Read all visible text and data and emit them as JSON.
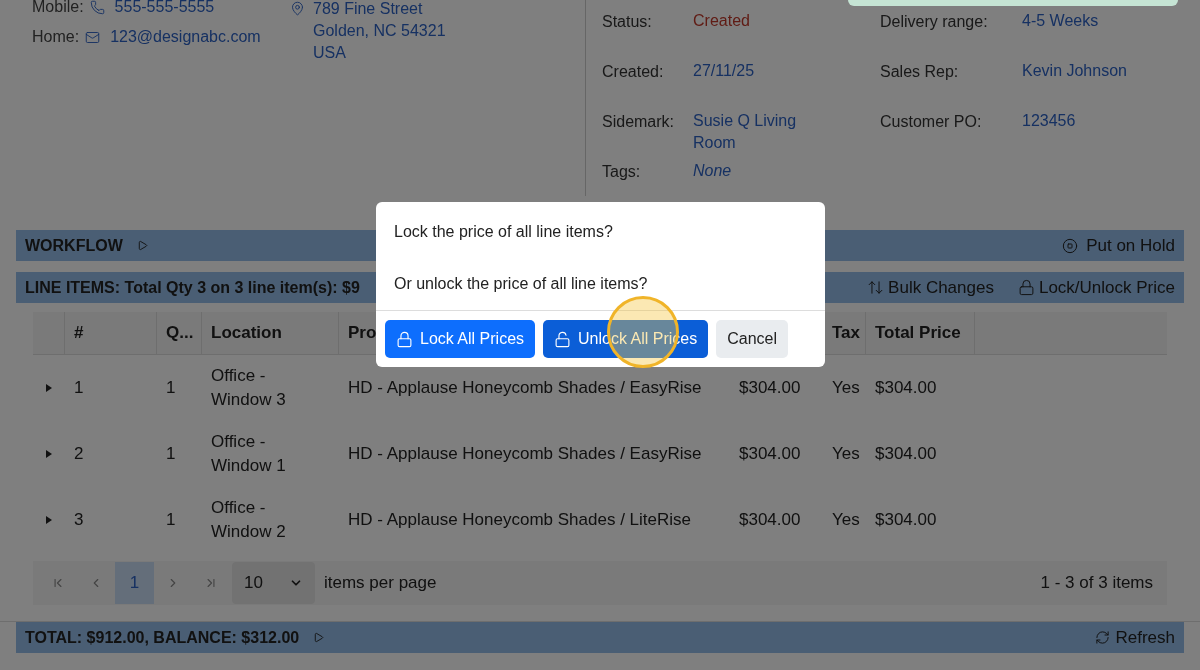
{
  "contact": {
    "rows": [
      {
        "label": "Mobile:",
        "kind": "phone",
        "value": "555-555-5555"
      },
      {
        "label": "Home:",
        "kind": "email",
        "value": "123@designabc.com"
      }
    ],
    "address": [
      "789 Fine Street",
      "Golden, NC 54321",
      "USA"
    ]
  },
  "details_left": [
    {
      "label": "Status:",
      "value": "Created",
      "kind": "status"
    },
    {
      "label": "Created:",
      "value": "27/11/25",
      "kind": "link"
    },
    {
      "label": "Sidemark:",
      "value": "Susie Q Living Room",
      "kind": "link"
    },
    {
      "label": "Tags:",
      "value": "None",
      "kind": "empty"
    }
  ],
  "details_right": [
    {
      "label": "Delivery range:",
      "value": "4-5 Weeks",
      "kind": "link"
    },
    {
      "label": "Sales Rep:",
      "value": "Kevin Johnson",
      "kind": "link"
    },
    {
      "label": "Customer PO:",
      "value": "123456",
      "kind": "link"
    }
  ],
  "workflow": {
    "title": "WORKFLOW",
    "action": "Put on Hold"
  },
  "line_items": {
    "title": "LINE ITEMS: Total Qty 3 on 3 line item(s): $9",
    "actions": [
      {
        "label": "Bulk Changes",
        "kind": "bulk"
      },
      {
        "label": "Lock/Unlock Price",
        "kind": "lock"
      }
    ]
  },
  "table": {
    "columns": [
      {
        "label": "#"
      },
      {
        "label": "Q..."
      },
      {
        "label": "Location"
      },
      {
        "label": "Pro"
      },
      {},
      {
        "label": "Tax"
      },
      {
        "label": "Total Price"
      }
    ],
    "rows": [
      {
        "expanded": false,
        "cells": [
          "1",
          "1",
          "Office - Window 3",
          "HD - Applause Honeycomb Shades / EasyRise",
          "$304.00",
          "Yes",
          "$304.00"
        ]
      },
      {
        "expanded": false,
        "cells": [
          "2",
          "1",
          "Office - Window 1",
          "HD - Applause Honeycomb Shades / EasyRise",
          "$304.00",
          "Yes",
          "$304.00"
        ]
      },
      {
        "expanded": false,
        "cells": [
          "3",
          "1",
          "Office - Window 2",
          "HD - Applause Honeycomb Shades / LiteRise",
          "$304.00",
          "Yes",
          "$304.00"
        ]
      }
    ]
  },
  "pager": {
    "pages": [
      {
        "label": "1",
        "selected": true
      }
    ],
    "page_size": "10",
    "per_page_label": "items per page",
    "summary": "1 - 3 of 3 items"
  },
  "total_bar": {
    "title": "TOTAL: $912.00, BALANCE: $312.00",
    "action": "Refresh"
  },
  "dialog": {
    "lines": [
      "Lock the price of all line items?",
      "Or unlock the price of all line items?"
    ],
    "buttons": [
      {
        "label": "Lock All Prices",
        "kind": "lock"
      },
      {
        "label": "Unlock All Prices",
        "kind": "unlock"
      },
      {
        "label": "Cancel",
        "kind": "cancel"
      }
    ]
  }
}
